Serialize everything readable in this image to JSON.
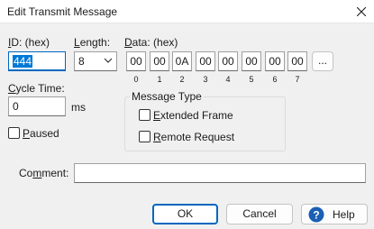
{
  "window": {
    "title": "Edit Transmit Message"
  },
  "id": {
    "label_hotkey": "I",
    "label_rest": "D: (hex)",
    "value": "444"
  },
  "length": {
    "label_hotkey": "L",
    "label_rest": "ength:",
    "value": "8"
  },
  "data": {
    "label_hotkey": "D",
    "label_rest": "ata: (hex)",
    "bytes": [
      "00",
      "00",
      "0A",
      "00",
      "00",
      "00",
      "00",
      "00"
    ],
    "indices": [
      "0",
      "1",
      "2",
      "3",
      "4",
      "5",
      "6",
      "7"
    ],
    "more_label": "..."
  },
  "cycle": {
    "label_hotkey": "C",
    "label_rest": "ycle Time:",
    "value": "0",
    "unit": "ms"
  },
  "paused": {
    "label_hotkey": "P",
    "label_rest": "aused",
    "checked": false
  },
  "message_type": {
    "title": "Message Type",
    "extended_hotkey": "E",
    "extended_rest": "xtended Frame",
    "extended_checked": false,
    "remote_hotkey": "R",
    "remote_rest": "emote Request",
    "remote_checked": false
  },
  "comment": {
    "label_pre": "Co",
    "label_hotkey": "m",
    "label_rest": "ment:",
    "value": ""
  },
  "buttons": {
    "ok": "OK",
    "cancel": "Cancel",
    "help": "Help"
  },
  "colors": {
    "accent": "#0067c0",
    "selection": "#0078d7",
    "help_icon": "#1a5fb4"
  },
  "icons": {
    "close": "close-icon",
    "chevron": "chevron-down-icon",
    "help": "help-icon"
  }
}
